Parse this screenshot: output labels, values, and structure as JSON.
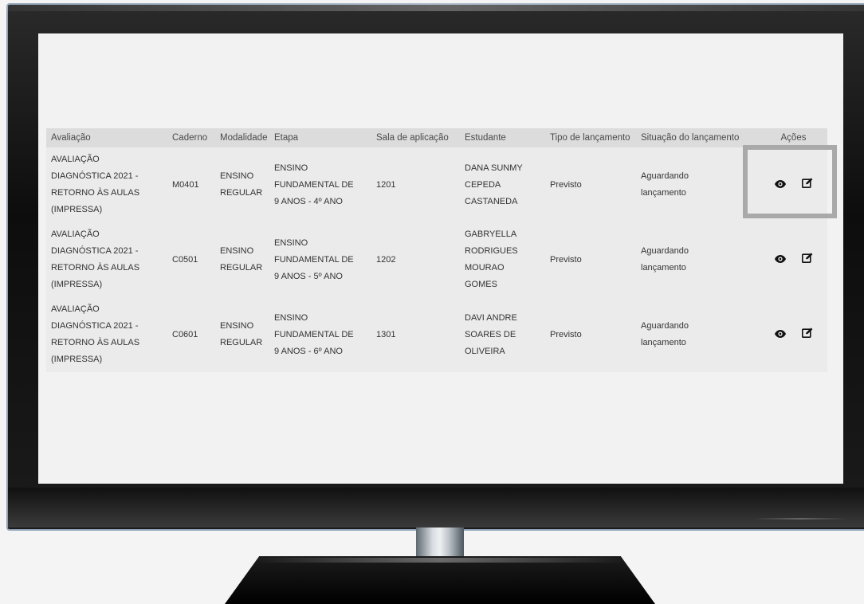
{
  "table": {
    "headers": [
      "Avaliação",
      "Caderno",
      "Modalidade",
      "Etapa",
      "Sala de aplicação",
      "Estudante",
      "Tipo de lançamento",
      "Situação do lançamento",
      "Ações"
    ],
    "rows": [
      {
        "avaliacao": [
          "AVALIAÇÃO",
          "DIAGNÓSTICA 2021 -",
          "RETORNO ÀS AULAS",
          "(IMPRESSA)"
        ],
        "caderno": "M0401",
        "modalidade": [
          "ENSINO",
          "REGULAR"
        ],
        "etapa": [
          "ENSINO",
          "FUNDAMENTAL DE",
          "9 ANOS - 4º ANO"
        ],
        "sala": "1201",
        "estudante": [
          "DANA SUNMY",
          "CEPEDA",
          "CASTANEDA"
        ],
        "tipo": "Previsto",
        "situacao": [
          "Aguardando",
          "lançamento"
        ]
      },
      {
        "avaliacao": [
          "AVALIAÇÃO",
          "DIAGNÓSTICA 2021 -",
          "RETORNO ÀS AULAS",
          "(IMPRESSA)"
        ],
        "caderno": "C0501",
        "modalidade": [
          "ENSINO",
          "REGULAR"
        ],
        "etapa": [
          "ENSINO",
          "FUNDAMENTAL DE",
          "9 ANOS - 5º ANO"
        ],
        "sala": "1202",
        "estudante": [
          "GABRYELLA",
          "RODRIGUES",
          "MOURAO",
          "GOMES"
        ],
        "tipo": "Previsto",
        "situacao": [
          "Aguardando",
          "lançamento"
        ]
      },
      {
        "avaliacao": [
          "AVALIAÇÃO",
          "DIAGNÓSTICA 2021 -",
          "RETORNO ÀS AULAS",
          "(IMPRESSA)"
        ],
        "caderno": "C0601",
        "modalidade": [
          "ENSINO",
          "REGULAR"
        ],
        "etapa": [
          "ENSINO",
          "FUNDAMENTAL DE",
          "9 ANOS - 6º ANO"
        ],
        "sala": "1301",
        "estudante": [
          "DAVI ANDRE",
          "SOARES DE",
          "OLIVEIRA"
        ],
        "tipo": "Previsto",
        "situacao": [
          "Aguardando",
          "lançamento"
        ]
      }
    ]
  },
  "icons": {
    "view": "eye-icon",
    "edit": "edit-icon"
  },
  "colors": {
    "header_bg": "#dcdcdc",
    "row_bg": "#ebebeb",
    "screen_bg": "#f2f2f2",
    "highlight_border": "#a9a9a9"
  }
}
